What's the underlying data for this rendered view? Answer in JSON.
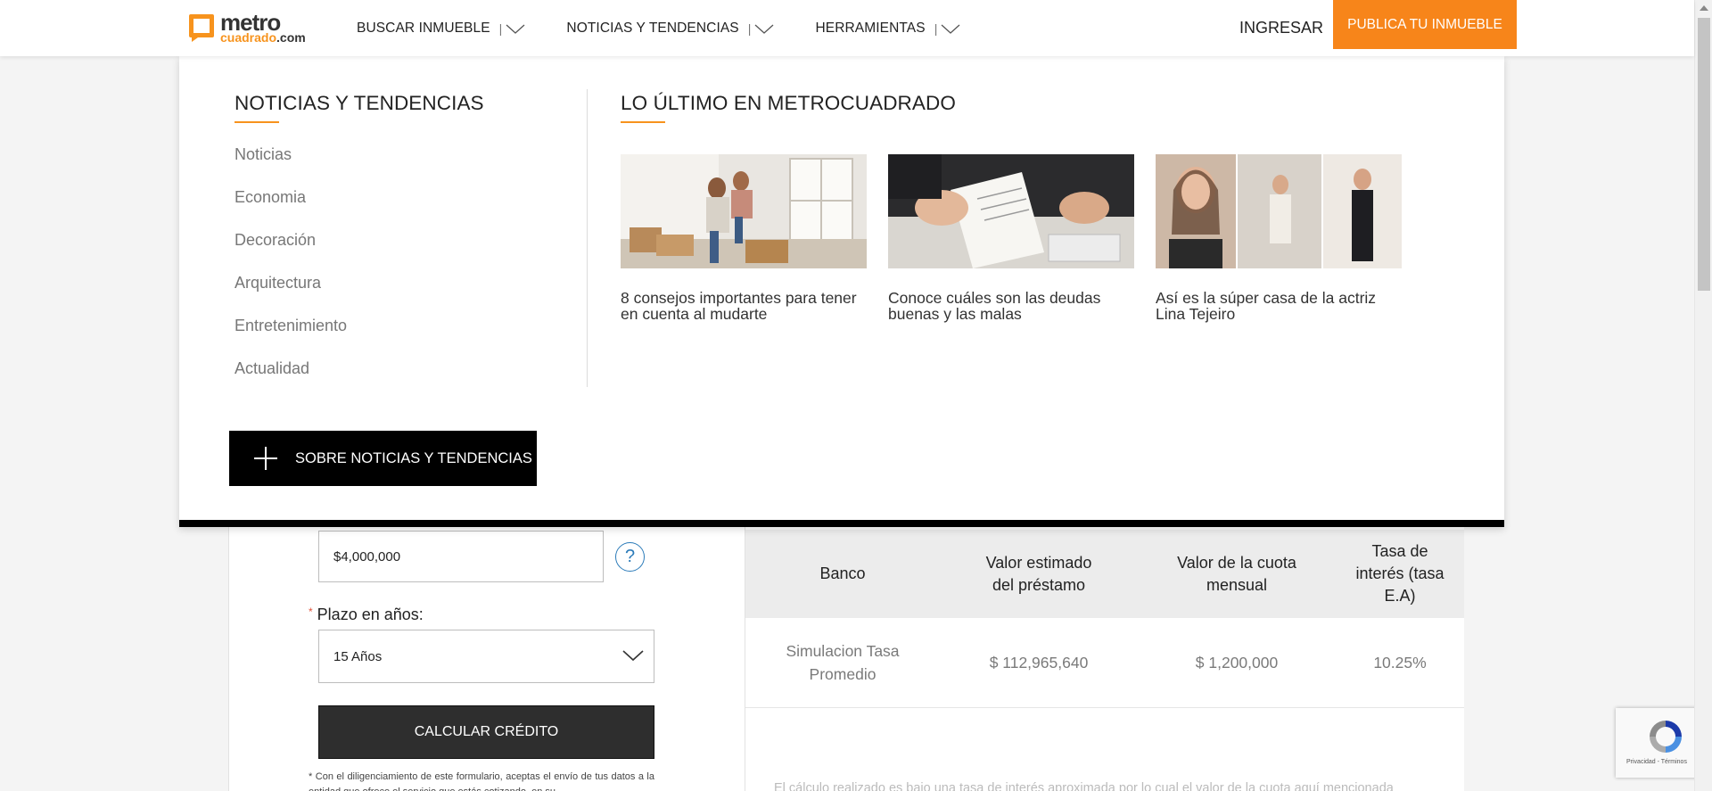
{
  "header": {
    "logo": {
      "main": "metro",
      "sub": "cuadrado",
      "suffix": ".com"
    },
    "nav": [
      {
        "label": "BUSCAR INMUEBLE",
        "icon": "chevron-down-icon"
      },
      {
        "label": "NOTICIAS Y TENDENCIAS",
        "icon": "chevron-down-icon"
      },
      {
        "label": "HERRAMIENTAS",
        "icon": "chevron-down-icon"
      }
    ],
    "nav_separator": "|",
    "login": "INGRESAR",
    "publish": "PUBLICA TU INMUEBLE"
  },
  "mega_menu": {
    "left_title": "NOTICIAS Y TENDENCIAS",
    "items": [
      "Noticias",
      "Economia",
      "Decoración",
      "Arquitectura",
      "Entretenimiento",
      "Actualidad"
    ],
    "more_button": "SOBRE NOTICIAS Y TENDENCIAS",
    "right_title": "LO ÚLTIMO EN METROCUADRADO",
    "articles": [
      {
        "caption": "8 consejos importantes para tener en cuenta al mudarte"
      },
      {
        "caption": "Conoce cuáles son las deudas buenas y las malas"
      },
      {
        "caption": "Así es la súper casa de la actriz Lina Tejeiro"
      }
    ]
  },
  "form": {
    "amount_value": "$4,000,000",
    "help_icon": "?",
    "plazo_required": "*",
    "plazo_label": "Plazo en años:",
    "plazo_value": "15 Años",
    "calc_button": "CALCULAR CRÉDITO",
    "disclaimer": "* Con el diligenciamiento de este formulario, aceptas el envío de tus datos a la entidad que ofrece el servicio que estás cotizando, en su"
  },
  "results": {
    "headers": [
      "Banco",
      "Valor estimado del préstamo",
      "Valor de la cuota mensual",
      "Tasa de interés (tasa E.A)"
    ],
    "row": [
      "Simulacion Tasa Promedio",
      "$ 112,965,640",
      "$ 1,200,000",
      "10.25%"
    ],
    "note": "El cálculo realizado es bajo una tasa de interés aproximada por lo cual el valor de la cuota aquí mencionada"
  },
  "recaptcha": {
    "text": "Privacidad - Términos"
  },
  "colors": {
    "accent": "#f7851a",
    "dark": "#2e2e2e",
    "link_blue": "#2b7bb9"
  }
}
